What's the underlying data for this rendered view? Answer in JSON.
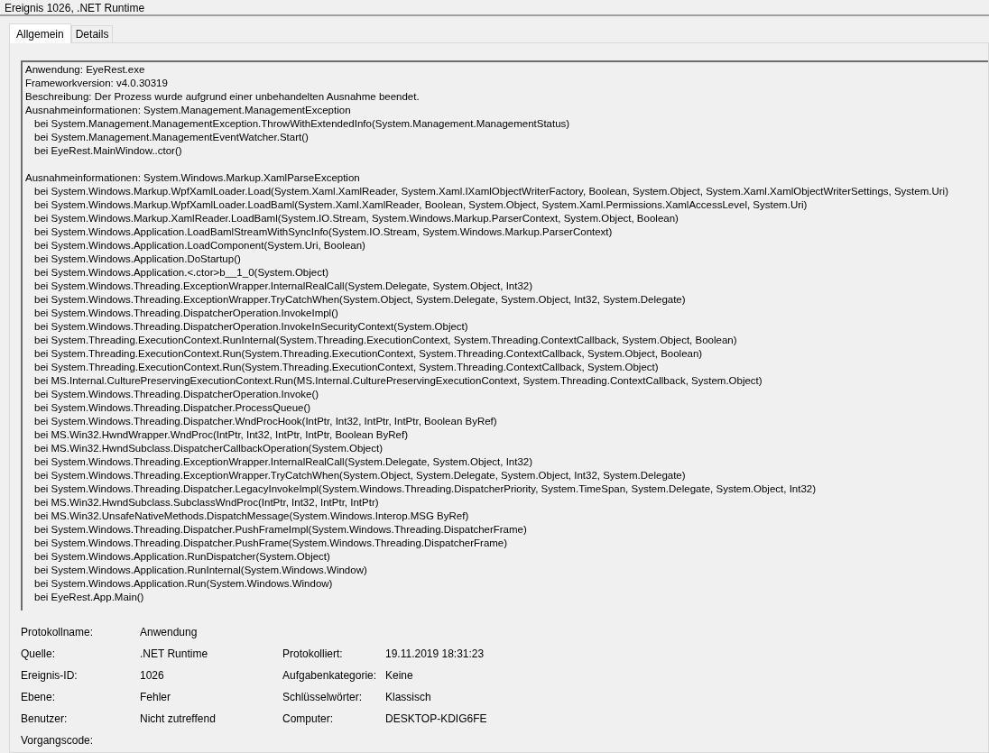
{
  "window": {
    "title": "Ereignis 1026, .NET Runtime"
  },
  "tabs": [
    {
      "label": "Allgemein",
      "selected": true
    },
    {
      "label": "Details",
      "selected": false
    }
  ],
  "description": {
    "intro": [
      "Anwendung: EyeRest.exe",
      "Frameworkversion: v4.0.30319",
      "Beschreibung: Der Prozess wurde aufgrund einer unbehandelten Ausnahme beendet."
    ],
    "exceptions": [
      {
        "info": "Ausnahmeinformationen: System.Management.ManagementException",
        "frames": [
          "bei System.Management.ManagementException.ThrowWithExtendedInfo(System.Management.ManagementStatus)",
          "bei System.Management.ManagementEventWatcher.Start()",
          "bei EyeRest.MainWindow..ctor()"
        ]
      },
      {
        "info": "Ausnahmeinformationen: System.Windows.Markup.XamlParseException",
        "frames": [
          "bei System.Windows.Markup.WpfXamlLoader.Load(System.Xaml.XamlReader, System.Xaml.IXamlObjectWriterFactory, Boolean, System.Object, System.Xaml.XamlObjectWriterSettings, System.Uri)",
          "bei System.Windows.Markup.WpfXamlLoader.LoadBaml(System.Xaml.XamlReader, Boolean, System.Object, System.Xaml.Permissions.XamlAccessLevel, System.Uri)",
          "bei System.Windows.Markup.XamlReader.LoadBaml(System.IO.Stream, System.Windows.Markup.ParserContext, System.Object, Boolean)",
          "bei System.Windows.Application.LoadBamlStreamWithSyncInfo(System.IO.Stream, System.Windows.Markup.ParserContext)",
          "bei System.Windows.Application.LoadComponent(System.Uri, Boolean)",
          "bei System.Windows.Application.DoStartup()",
          "bei System.Windows.Application.<.ctor>b__1_0(System.Object)",
          "bei System.Windows.Threading.ExceptionWrapper.InternalRealCall(System.Delegate, System.Object, Int32)",
          "bei System.Windows.Threading.ExceptionWrapper.TryCatchWhen(System.Object, System.Delegate, System.Object, Int32, System.Delegate)",
          "bei System.Windows.Threading.DispatcherOperation.InvokeImpl()",
          "bei System.Windows.Threading.DispatcherOperation.InvokeInSecurityContext(System.Object)",
          "bei System.Threading.ExecutionContext.RunInternal(System.Threading.ExecutionContext, System.Threading.ContextCallback, System.Object, Boolean)",
          "bei System.Threading.ExecutionContext.Run(System.Threading.ExecutionContext, System.Threading.ContextCallback, System.Object, Boolean)",
          "bei System.Threading.ExecutionContext.Run(System.Threading.ExecutionContext, System.Threading.ContextCallback, System.Object)",
          "bei MS.Internal.CulturePreservingExecutionContext.Run(MS.Internal.CulturePreservingExecutionContext, System.Threading.ContextCallback, System.Object)",
          "bei System.Windows.Threading.DispatcherOperation.Invoke()",
          "bei System.Windows.Threading.Dispatcher.ProcessQueue()",
          "bei System.Windows.Threading.Dispatcher.WndProcHook(IntPtr, Int32, IntPtr, IntPtr, Boolean ByRef)",
          "bei MS.Win32.HwndWrapper.WndProc(IntPtr, Int32, IntPtr, IntPtr, Boolean ByRef)",
          "bei MS.Win32.HwndSubclass.DispatcherCallbackOperation(System.Object)",
          "bei System.Windows.Threading.ExceptionWrapper.InternalRealCall(System.Delegate, System.Object, Int32)",
          "bei System.Windows.Threading.ExceptionWrapper.TryCatchWhen(System.Object, System.Delegate, System.Object, Int32, System.Delegate)",
          "bei System.Windows.Threading.Dispatcher.LegacyInvokeImpl(System.Windows.Threading.DispatcherPriority, System.TimeSpan, System.Delegate, System.Object, Int32)",
          "bei MS.Win32.HwndSubclass.SubclassWndProc(IntPtr, Int32, IntPtr, IntPtr)",
          "bei MS.Win32.UnsafeNativeMethods.DispatchMessage(System.Windows.Interop.MSG ByRef)",
          "bei System.Windows.Threading.Dispatcher.PushFrameImpl(System.Windows.Threading.DispatcherFrame)",
          "bei System.Windows.Threading.Dispatcher.PushFrame(System.Windows.Threading.DispatcherFrame)",
          "bei System.Windows.Application.RunDispatcher(System.Object)",
          "bei System.Windows.Application.RunInternal(System.Windows.Window)",
          "bei System.Windows.Application.Run(System.Windows.Window)",
          "bei EyeRest.App.Main()"
        ]
      }
    ]
  },
  "properties": [
    {
      "label": "Protokollname:",
      "value": "Anwendung"
    },
    {
      "label": "Quelle:",
      "value": ".NET Runtime",
      "label_2": "Protokolliert:",
      "value_2": "19.11.2019 18:31:23"
    },
    {
      "label": "Ereignis-ID:",
      "value": "1026",
      "label_2": "Aufgabenkategorie:",
      "value_2": "Keine"
    },
    {
      "label": "Ebene:",
      "value": "Fehler",
      "label_2": "Schlüsselwörter:",
      "value_2": "Klassisch"
    },
    {
      "label": "Benutzer:",
      "value": "Nicht zutreffend",
      "label_2": "Computer:",
      "value_2": "DESKTOP-KDIG6FE"
    },
    {
      "label": "Vorgangscode:"
    }
  ]
}
